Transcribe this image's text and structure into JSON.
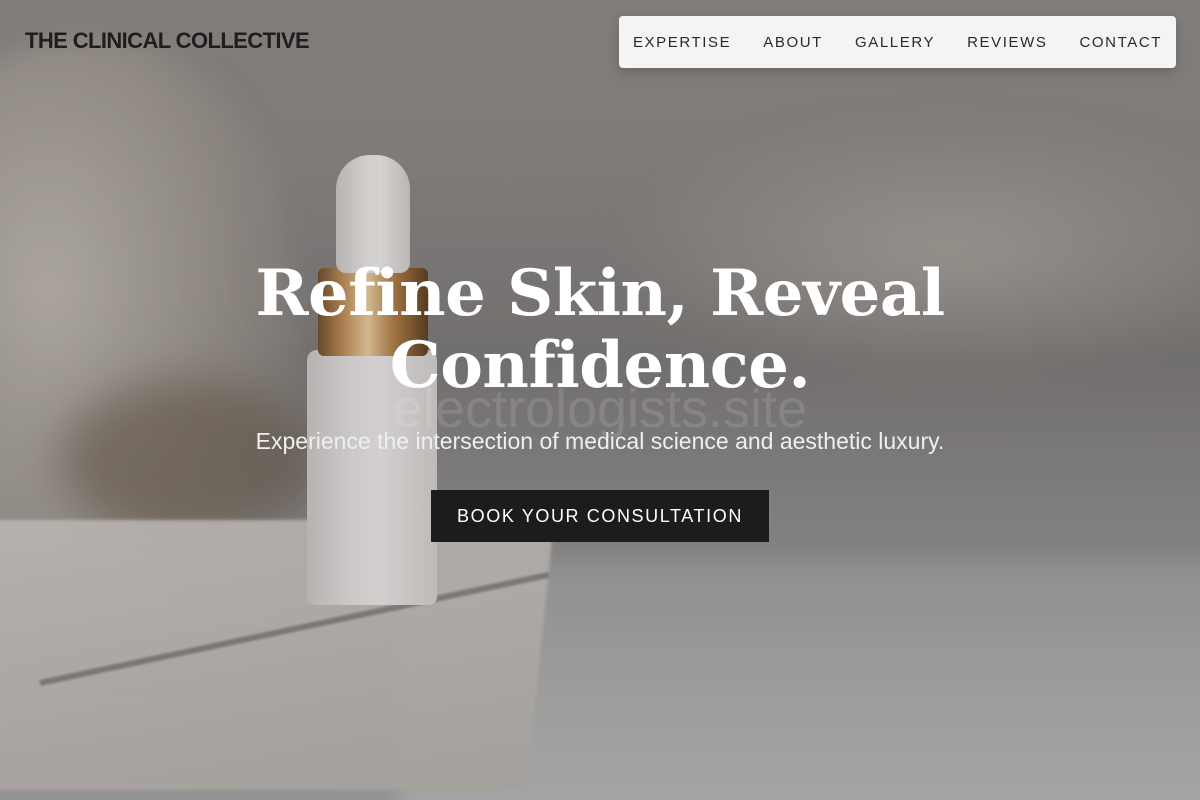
{
  "header": {
    "logo": "THE CLINICAL COLLECTIVE"
  },
  "nav": {
    "items": [
      {
        "label": "EXPERTISE"
      },
      {
        "label": "ABOUT"
      },
      {
        "label": "GALLERY"
      },
      {
        "label": "REVIEWS"
      },
      {
        "label": "CONTACT"
      }
    ]
  },
  "hero": {
    "headline_line1": "Refine Skin, Reveal",
    "headline_line2": "Confidence.",
    "watermark": "electrologists.site",
    "subtitle": "Experience the intersection of medical science and aesthetic luxury.",
    "cta_label": "BOOK YOUR CONSULTATION",
    "background_image": "dropper-bottle-on-marble-tray"
  },
  "colors": {
    "cta_background": "#1c1c1c",
    "nav_background": "#f4f4f4",
    "headline_text": "#ffffff"
  }
}
